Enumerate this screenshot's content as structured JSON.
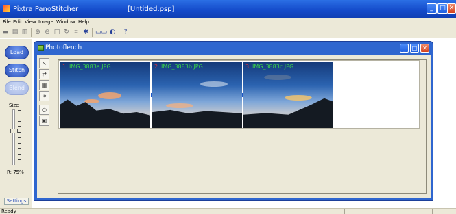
{
  "app": {
    "title": "Pixtra PanoStitcher",
    "document": "[Untitled.psp]",
    "window_buttons": [
      "_",
      "□",
      "✕"
    ]
  },
  "menu": [
    "File",
    "Edit",
    "View",
    "Image",
    "Window",
    "Help"
  ],
  "toolbar": {
    "icons": [
      "save-icon",
      "print-icon",
      "print-preview-icon",
      "zoom-in-icon",
      "zoom-out-icon",
      "fit-icon",
      "rotate-icon",
      "crop-icon",
      "settings-icon",
      "stitch-icon",
      "blend-icon",
      "help-icon"
    ]
  },
  "left_panel": {
    "buttons": [
      "Load",
      "Stitch",
      "Blend"
    ],
    "size_label": "Size",
    "ratio": "R: 75%",
    "settings": "Settings"
  },
  "inner_window": {
    "title": "Photoflench",
    "buttons": [
      "_",
      "□",
      "✕"
    ]
  },
  "images": [
    {
      "num": "1",
      "name": "IMG_3883a.JPG"
    },
    {
      "num": "2",
      "name": "IMG_3883b.JPG"
    },
    {
      "num": "3",
      "name": "IMG_3883c.JPG"
    }
  ],
  "status": {
    "text": "Ready"
  },
  "colors": {
    "titlebar": "#1349c9",
    "image_label": "#39d24a",
    "image_number": "#e0333a"
  }
}
